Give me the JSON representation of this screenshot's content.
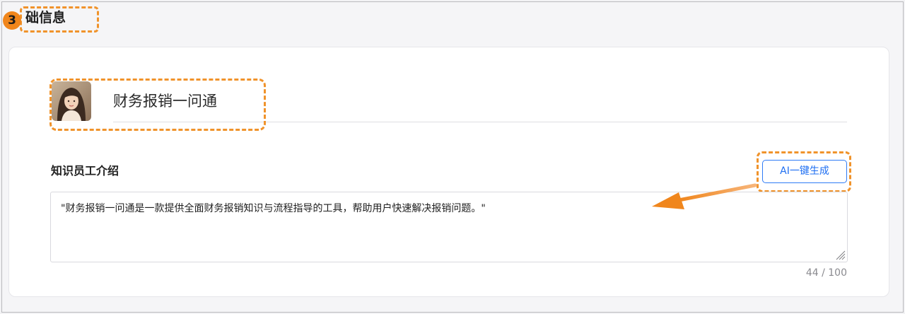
{
  "step": {
    "number": "3"
  },
  "section": {
    "title": "础信息"
  },
  "agent": {
    "name": "财务报销一问通",
    "avatar": "avatar-photo"
  },
  "intro": {
    "label": "知识员工介绍",
    "ai_button_label": "AI一键生成",
    "text": "\"财务报销一问通是一款提供全面财务报销知识与流程指导的工具，帮助用户快速解决报销问题。\"",
    "char_count": "44 / 100"
  },
  "colors": {
    "accent": "#2f7cf6",
    "highlight": "#f0932b",
    "badge": "#f0861c"
  }
}
